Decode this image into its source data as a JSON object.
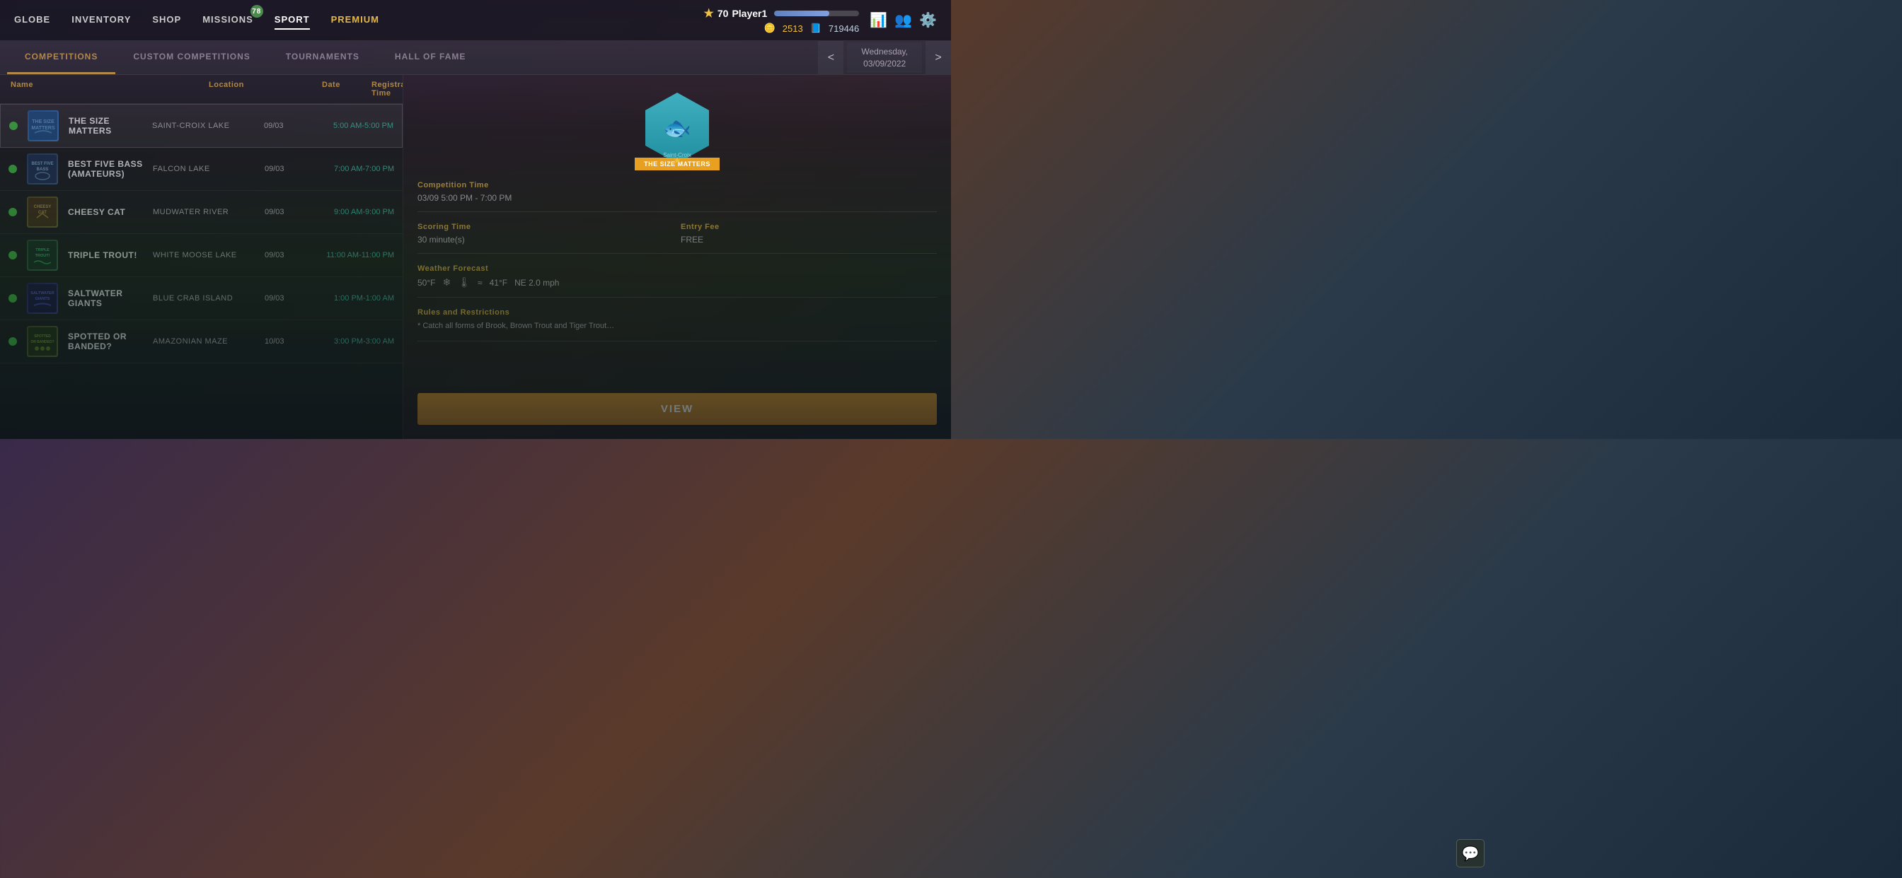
{
  "nav": {
    "links": [
      {
        "id": "globe",
        "label": "GLOBE",
        "active": false
      },
      {
        "id": "inventory",
        "label": "INVENTORY",
        "active": false
      },
      {
        "id": "shop",
        "label": "SHOP",
        "active": false
      },
      {
        "id": "missions",
        "label": "MISSIONS",
        "active": false,
        "badge": "78"
      },
      {
        "id": "sport",
        "label": "SPORT",
        "active": true
      },
      {
        "id": "premium",
        "label": "PREMIUM",
        "active": false,
        "premium": true
      }
    ]
  },
  "player": {
    "level": "70",
    "name": "Player1",
    "coins": "2513",
    "premium": "719446",
    "progress": 65
  },
  "tabs": [
    {
      "id": "competitions",
      "label": "COMPETITIONS",
      "active": true
    },
    {
      "id": "custom-competitions",
      "label": "CUSTOM COMPETITIONS",
      "active": false
    },
    {
      "id": "tournaments",
      "label": "TOURNAMENTS",
      "active": false
    },
    {
      "id": "hall-of-fame",
      "label": "HALL OF FAME",
      "active": false
    }
  ],
  "date": {
    "prev_label": "<",
    "next_label": ">",
    "display_line1": "Wednesday,",
    "display_line2": "03/09/2022"
  },
  "columns": {
    "name": "Name",
    "location": "Location",
    "date": "Date",
    "registration_time": "Registration Time"
  },
  "competitions": [
    {
      "id": 1,
      "name": "THE SIZE MATTERS",
      "location": "SAINT-CROIX LAKE",
      "date": "09/03",
      "time": "5:00 AM-5:00 PM",
      "status": "active",
      "selected": true,
      "logo_type": "size-matters"
    },
    {
      "id": 2,
      "name": "BEST FIVE BASS (AMATEURS)",
      "location": "FALCON LAKE",
      "date": "09/03",
      "time": "7:00 AM-7:00 PM",
      "status": "active",
      "selected": false,
      "logo_type": "best-five-bass"
    },
    {
      "id": 3,
      "name": "CHEESY CAT",
      "location": "MUDWATER RIVER",
      "date": "09/03",
      "time": "9:00 AM-9:00 PM",
      "status": "active",
      "selected": false,
      "logo_type": "cheesy-cat"
    },
    {
      "id": 4,
      "name": "TRIPLE TROUT!",
      "location": "WHITE MOOSE LAKE",
      "date": "09/03",
      "time": "11:00 AM-11:00 PM",
      "status": "active",
      "selected": false,
      "logo_type": "triple-trout"
    },
    {
      "id": 5,
      "name": "SALTWATER GIANTS",
      "location": "BLUE CRAB ISLAND",
      "date": "09/03",
      "time": "1:00 PM-1:00 AM",
      "status": "active",
      "selected": false,
      "logo_type": "saltwater"
    },
    {
      "id": 6,
      "name": "SPOTTED OR BANDED?",
      "location": "AMAZONIAN MAZE",
      "date": "10/03",
      "time": "3:00 PM-3:00 AM",
      "status": "active",
      "selected": false,
      "logo_type": "spotted"
    }
  ],
  "detail": {
    "badge_name": "THE SIZE MATTERS",
    "badge_sub": "Saint-Croix",
    "competition_time_label": "Competition Time",
    "competition_time_value": "03/09 5:00 PM - 7:00 PM",
    "scoring_time_label": "Scoring Time",
    "scoring_time_value": "30 minute(s)",
    "entry_fee_label": "Entry Fee",
    "entry_fee_value": "FREE",
    "weather_label": "Weather Forecast",
    "weather_temp1": "50°F",
    "weather_icon1": "❄",
    "weather_icon2": "🌡",
    "weather_temp2": "41°F",
    "weather_wind_dir": "NE 2.0 mph",
    "weather_wind_icon": "≈",
    "rules_label": "Rules and Restrictions",
    "rules_text": "* Catch all forms of Brook, Brown Trout and Tiger Trout…",
    "view_button": "VIEW"
  },
  "chat_icon": "💬"
}
